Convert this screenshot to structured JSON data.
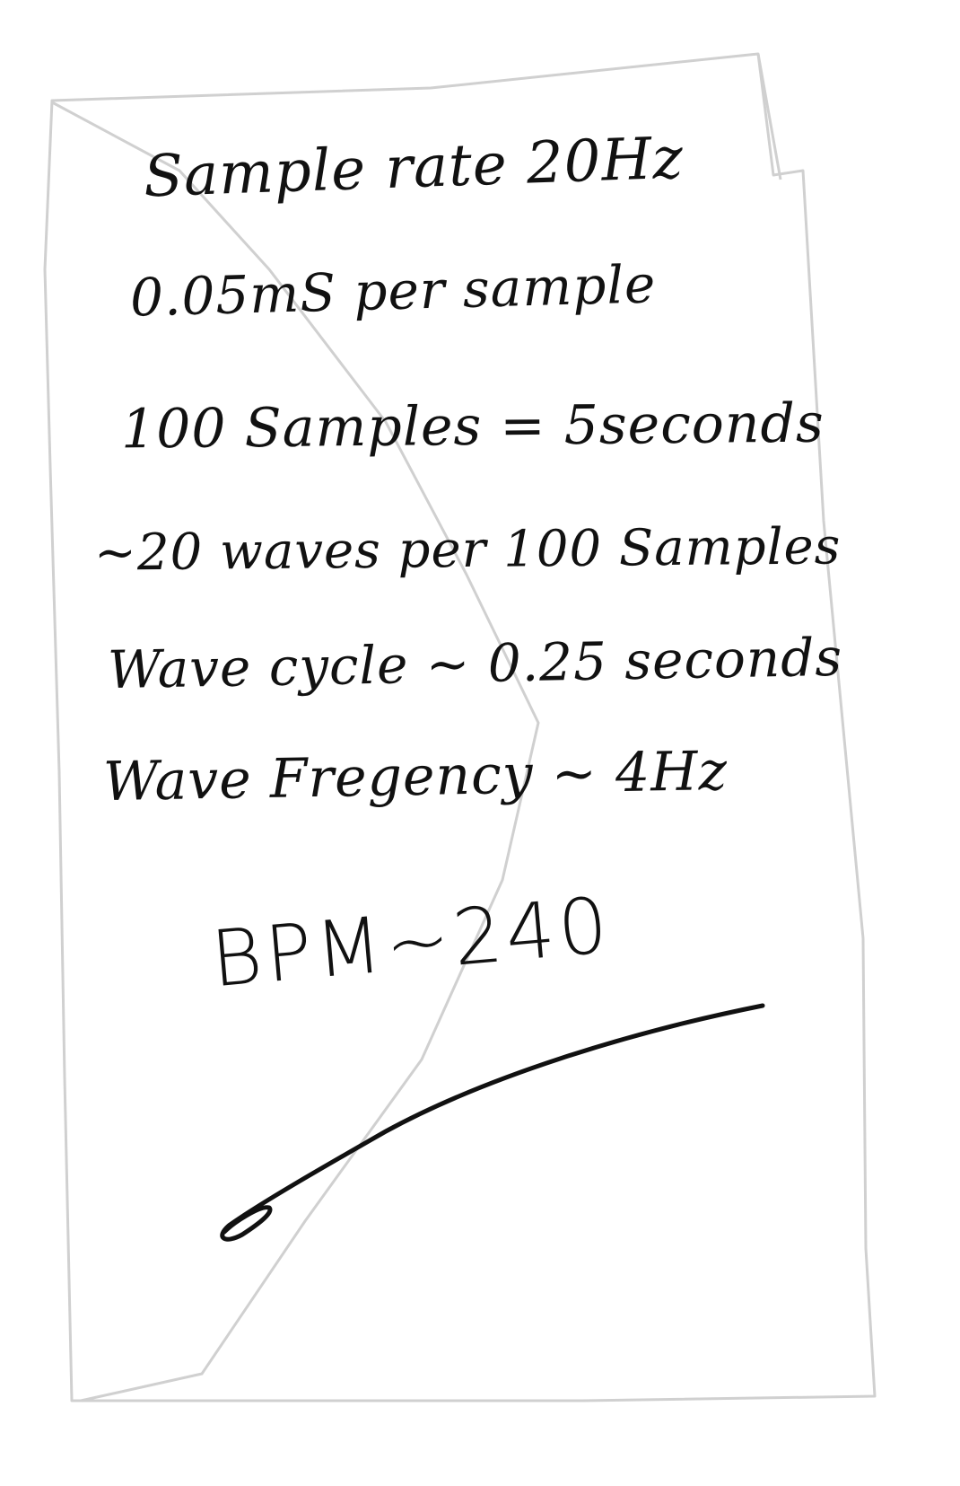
{
  "note": {
    "lines": [
      "Sample rate 20Hz",
      "0.05mS per sample",
      "100 Samples = 5seconds",
      "~20 waves per 100 Samples",
      "Wave cycle ~ 0.25 seconds",
      "Wave Fregency ~ 4Hz",
      "BPM~240"
    ]
  },
  "colors": {
    "ink": "#111111",
    "paper_outline": "#d0d0d0",
    "background": "#ffffff"
  }
}
